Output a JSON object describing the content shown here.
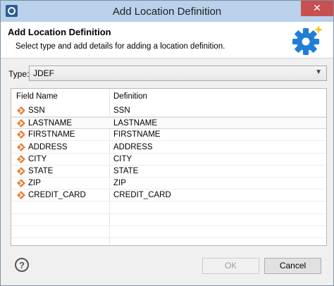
{
  "window": {
    "title": "Add Location Definition",
    "close_glyph": "✕"
  },
  "banner": {
    "title": "Add Location Definition",
    "description": "Select type and add details for adding a location definition.",
    "icon": "gear-icon"
  },
  "type_field": {
    "label": "Type:",
    "value": "JDEF"
  },
  "table": {
    "columns": [
      "Field Name",
      "Definition"
    ],
    "rows": [
      {
        "name": "SSN",
        "definition": "SSN"
      },
      {
        "name": "LASTNAME",
        "definition": "LASTNAME"
      },
      {
        "name": "FIRSTNAME",
        "definition": "FIRSTNAME"
      },
      {
        "name": "ADDRESS",
        "definition": "ADDRESS"
      },
      {
        "name": "CITY",
        "definition": "CITY"
      },
      {
        "name": "STATE",
        "definition": "STATE"
      },
      {
        "name": "ZIP",
        "definition": "ZIP"
      },
      {
        "name": "CREDIT_CARD",
        "definition": "CREDIT_CARD"
      }
    ],
    "selected_row": "LASTNAME"
  },
  "footer": {
    "help_glyph": "?",
    "ok_label": "OK",
    "cancel_label": "Cancel"
  },
  "colors": {
    "titlebar": "#b9d1ea",
    "close": "#c75050",
    "row_icon": "#e8823a",
    "gear": "#1f7fd6"
  }
}
